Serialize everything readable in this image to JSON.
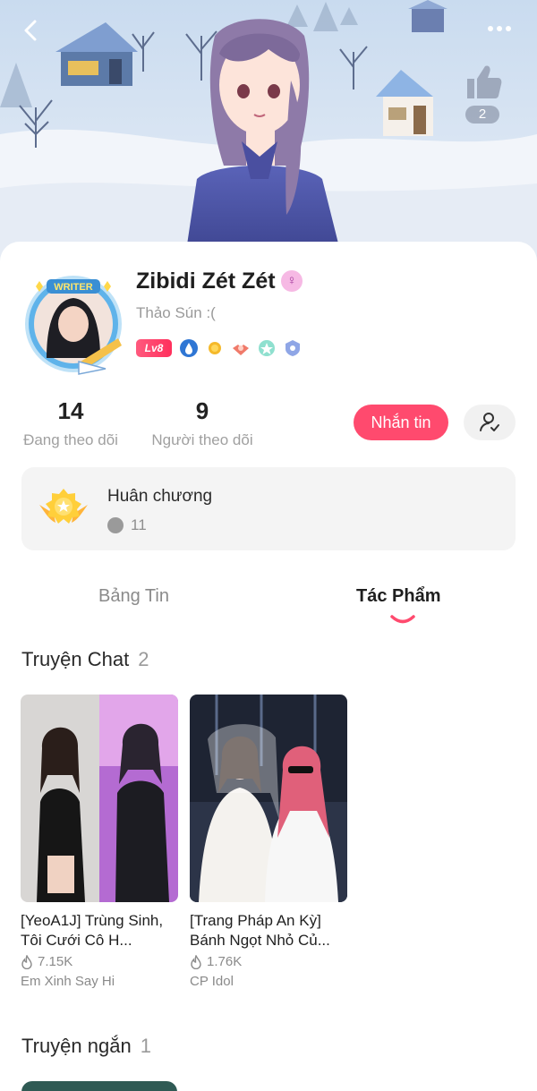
{
  "header": {
    "back_icon": "chevron-left-icon",
    "more_icon": "more-dots-icon",
    "like_icon": "thumbs-up-icon",
    "like_count": "2"
  },
  "profile": {
    "writer_badge": "WRITER",
    "name": "Zibidi Zét Zét",
    "gender_icon": "female-symbol-icon",
    "bio": "Thảo Sún :(",
    "level": "Lv8",
    "following_count": "14",
    "following_label": "Đang theo dõi",
    "followers_count": "9",
    "followers_label": "Người theo dõi",
    "message_button": "Nhắn tin"
  },
  "medals": {
    "title": "Huân chương",
    "count": "11"
  },
  "tabs": [
    {
      "label": "Bảng Tin",
      "active": false
    },
    {
      "label": "Tác Phẩm",
      "active": true
    }
  ],
  "chat_stories": {
    "title": "Truyện Chat",
    "count": "2",
    "items": [
      {
        "title": "[YeoA1J] Trùng Sinh, Tôi Cưới Cô H...",
        "views": "7.15K",
        "author": "Em Xinh Say Hi"
      },
      {
        "title": "[Trang Pháp An Kỳ] Bánh Ngọt Nhỏ Củ...",
        "views": "1.76K",
        "author": "CP Idol"
      }
    ]
  },
  "short_stories": {
    "title": "Truyện ngắn",
    "count": "1"
  },
  "colors": {
    "accent": "#ff4a6e",
    "muted_text": "#9a9a9a"
  }
}
